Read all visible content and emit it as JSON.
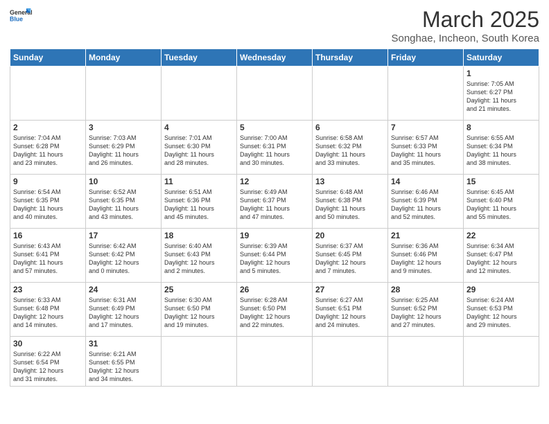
{
  "header": {
    "logo_general": "General",
    "logo_blue": "Blue",
    "month_title": "March 2025",
    "location": "Songhae, Incheon, South Korea"
  },
  "weekdays": [
    "Sunday",
    "Monday",
    "Tuesday",
    "Wednesday",
    "Thursday",
    "Friday",
    "Saturday"
  ],
  "weeks": [
    [
      {
        "day": "",
        "info": ""
      },
      {
        "day": "",
        "info": ""
      },
      {
        "day": "",
        "info": ""
      },
      {
        "day": "",
        "info": ""
      },
      {
        "day": "",
        "info": ""
      },
      {
        "day": "",
        "info": ""
      },
      {
        "day": "1",
        "info": "Sunrise: 7:05 AM\nSunset: 6:27 PM\nDaylight: 11 hours\nand 21 minutes."
      }
    ],
    [
      {
        "day": "2",
        "info": "Sunrise: 7:04 AM\nSunset: 6:28 PM\nDaylight: 11 hours\nand 23 minutes."
      },
      {
        "day": "3",
        "info": "Sunrise: 7:03 AM\nSunset: 6:29 PM\nDaylight: 11 hours\nand 26 minutes."
      },
      {
        "day": "4",
        "info": "Sunrise: 7:01 AM\nSunset: 6:30 PM\nDaylight: 11 hours\nand 28 minutes."
      },
      {
        "day": "5",
        "info": "Sunrise: 7:00 AM\nSunset: 6:31 PM\nDaylight: 11 hours\nand 30 minutes."
      },
      {
        "day": "6",
        "info": "Sunrise: 6:58 AM\nSunset: 6:32 PM\nDaylight: 11 hours\nand 33 minutes."
      },
      {
        "day": "7",
        "info": "Sunrise: 6:57 AM\nSunset: 6:33 PM\nDaylight: 11 hours\nand 35 minutes."
      },
      {
        "day": "8",
        "info": "Sunrise: 6:55 AM\nSunset: 6:34 PM\nDaylight: 11 hours\nand 38 minutes."
      }
    ],
    [
      {
        "day": "9",
        "info": "Sunrise: 6:54 AM\nSunset: 6:35 PM\nDaylight: 11 hours\nand 40 minutes."
      },
      {
        "day": "10",
        "info": "Sunrise: 6:52 AM\nSunset: 6:35 PM\nDaylight: 11 hours\nand 43 minutes."
      },
      {
        "day": "11",
        "info": "Sunrise: 6:51 AM\nSunset: 6:36 PM\nDaylight: 11 hours\nand 45 minutes."
      },
      {
        "day": "12",
        "info": "Sunrise: 6:49 AM\nSunset: 6:37 PM\nDaylight: 11 hours\nand 47 minutes."
      },
      {
        "day": "13",
        "info": "Sunrise: 6:48 AM\nSunset: 6:38 PM\nDaylight: 11 hours\nand 50 minutes."
      },
      {
        "day": "14",
        "info": "Sunrise: 6:46 AM\nSunset: 6:39 PM\nDaylight: 11 hours\nand 52 minutes."
      },
      {
        "day": "15",
        "info": "Sunrise: 6:45 AM\nSunset: 6:40 PM\nDaylight: 11 hours\nand 55 minutes."
      }
    ],
    [
      {
        "day": "16",
        "info": "Sunrise: 6:43 AM\nSunset: 6:41 PM\nDaylight: 11 hours\nand 57 minutes."
      },
      {
        "day": "17",
        "info": "Sunrise: 6:42 AM\nSunset: 6:42 PM\nDaylight: 12 hours\nand 0 minutes."
      },
      {
        "day": "18",
        "info": "Sunrise: 6:40 AM\nSunset: 6:43 PM\nDaylight: 12 hours\nand 2 minutes."
      },
      {
        "day": "19",
        "info": "Sunrise: 6:39 AM\nSunset: 6:44 PM\nDaylight: 12 hours\nand 5 minutes."
      },
      {
        "day": "20",
        "info": "Sunrise: 6:37 AM\nSunset: 6:45 PM\nDaylight: 12 hours\nand 7 minutes."
      },
      {
        "day": "21",
        "info": "Sunrise: 6:36 AM\nSunset: 6:46 PM\nDaylight: 12 hours\nand 9 minutes."
      },
      {
        "day": "22",
        "info": "Sunrise: 6:34 AM\nSunset: 6:47 PM\nDaylight: 12 hours\nand 12 minutes."
      }
    ],
    [
      {
        "day": "23",
        "info": "Sunrise: 6:33 AM\nSunset: 6:48 PM\nDaylight: 12 hours\nand 14 minutes."
      },
      {
        "day": "24",
        "info": "Sunrise: 6:31 AM\nSunset: 6:49 PM\nDaylight: 12 hours\nand 17 minutes."
      },
      {
        "day": "25",
        "info": "Sunrise: 6:30 AM\nSunset: 6:50 PM\nDaylight: 12 hours\nand 19 minutes."
      },
      {
        "day": "26",
        "info": "Sunrise: 6:28 AM\nSunset: 6:50 PM\nDaylight: 12 hours\nand 22 minutes."
      },
      {
        "day": "27",
        "info": "Sunrise: 6:27 AM\nSunset: 6:51 PM\nDaylight: 12 hours\nand 24 minutes."
      },
      {
        "day": "28",
        "info": "Sunrise: 6:25 AM\nSunset: 6:52 PM\nDaylight: 12 hours\nand 27 minutes."
      },
      {
        "day": "29",
        "info": "Sunrise: 6:24 AM\nSunset: 6:53 PM\nDaylight: 12 hours\nand 29 minutes."
      }
    ],
    [
      {
        "day": "30",
        "info": "Sunrise: 6:22 AM\nSunset: 6:54 PM\nDaylight: 12 hours\nand 31 minutes."
      },
      {
        "day": "31",
        "info": "Sunrise: 6:21 AM\nSunset: 6:55 PM\nDaylight: 12 hours\nand 34 minutes."
      },
      {
        "day": "",
        "info": ""
      },
      {
        "day": "",
        "info": ""
      },
      {
        "day": "",
        "info": ""
      },
      {
        "day": "",
        "info": ""
      },
      {
        "day": "",
        "info": ""
      }
    ]
  ]
}
